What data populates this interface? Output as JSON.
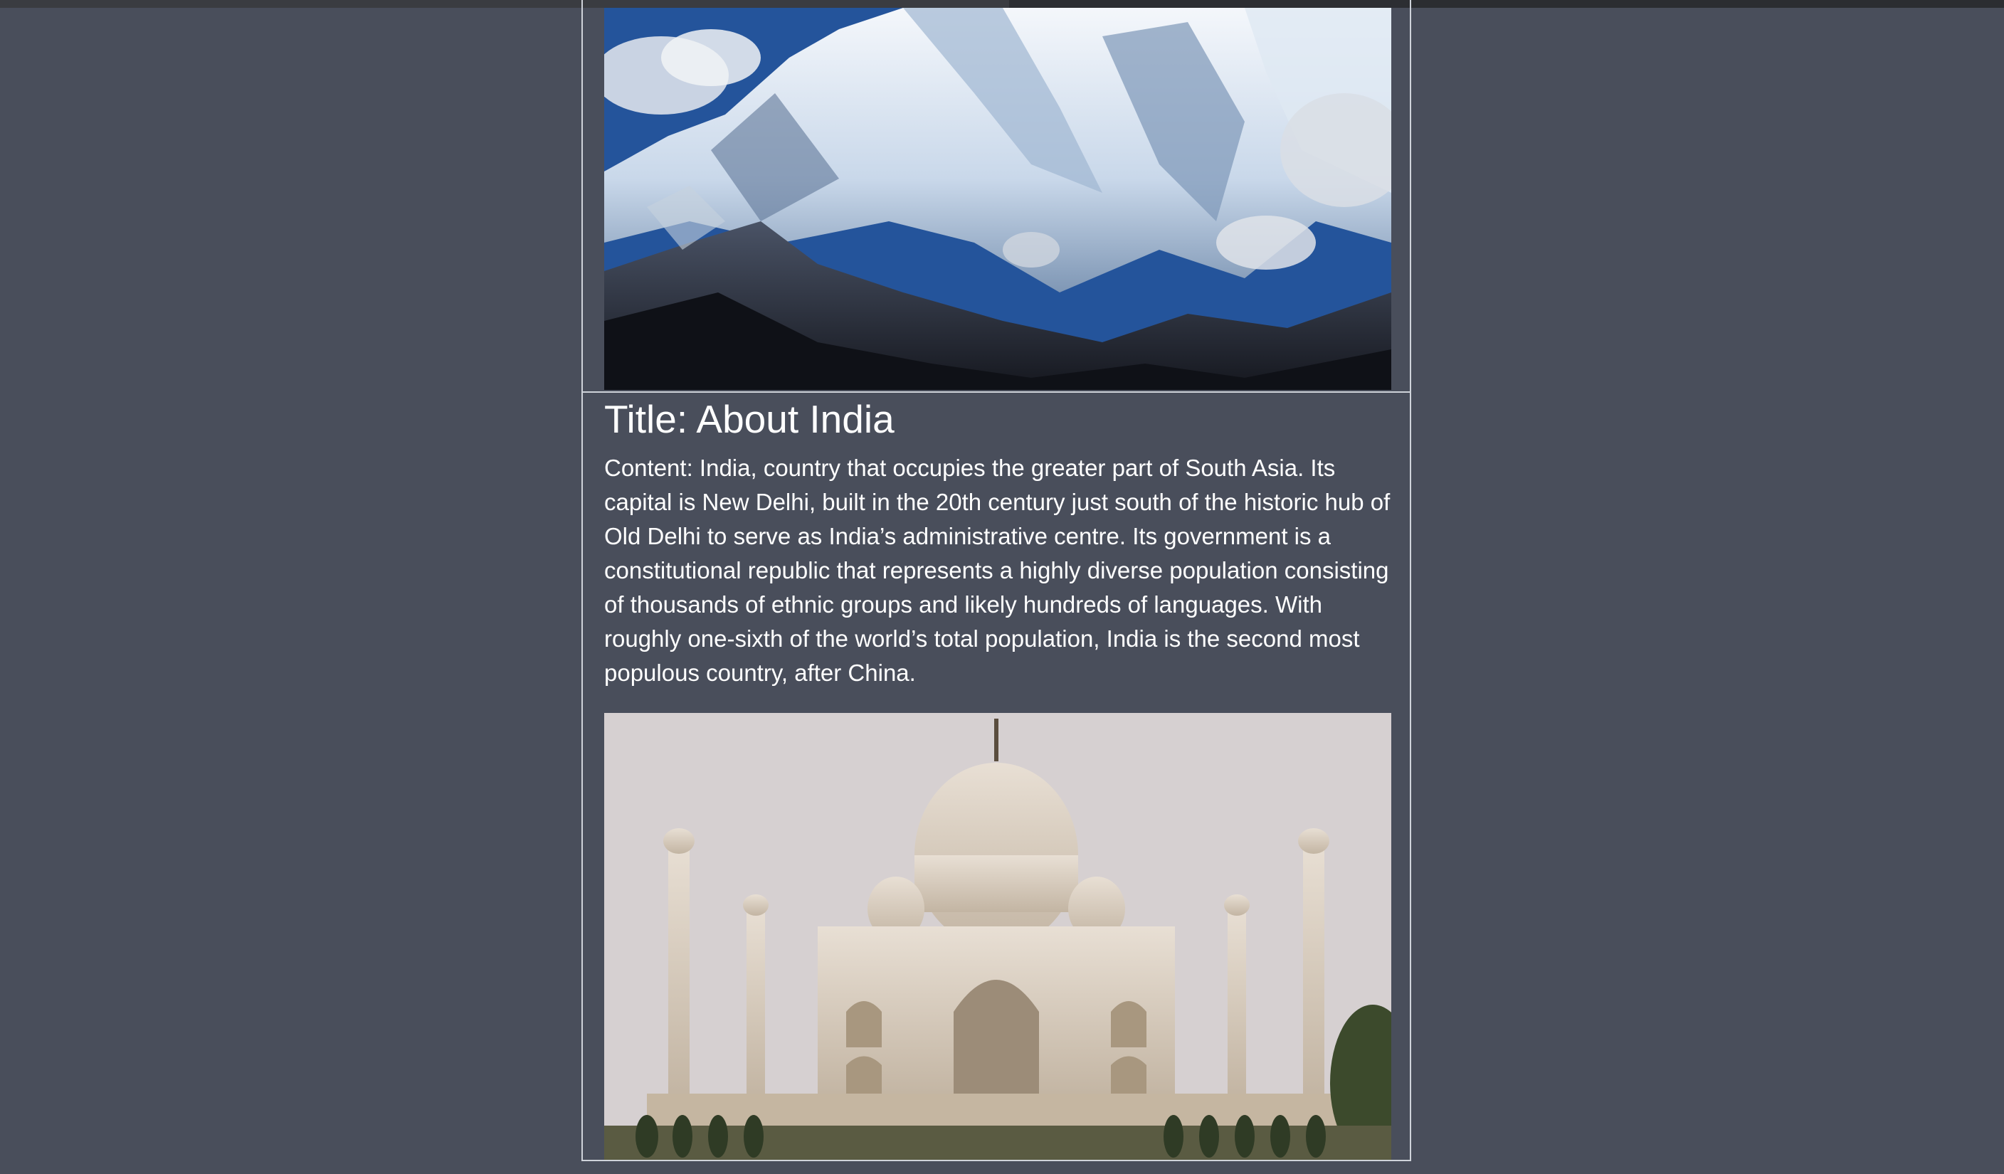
{
  "article": {
    "title": "Title: About India",
    "content": "Content: India, country that occupies the greater part of South Asia. Its capital is New Delhi, built in the 20th century just south of the historic hub of Old Delhi to serve as India’s administrative centre. Its government is a constitutional republic that represents a highly diverse population consisting of thousands of ethnic groups and likely hundreds of languages. With roughly one-sixth of the world’s total population, India is the second most populous country, after China."
  },
  "colors": {
    "page_background": "#494e5b",
    "card_border": "#cfd3da",
    "text": "#ffffff"
  }
}
